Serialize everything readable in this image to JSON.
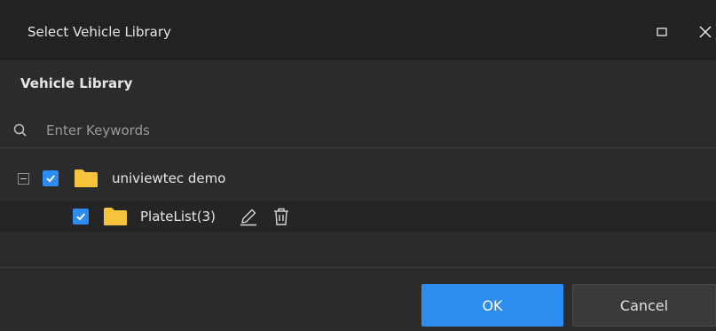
{
  "dialog": {
    "title": "Select Vehicle Library",
    "maximize_icon": "maximize-icon",
    "close_icon": "close-icon"
  },
  "library": {
    "section_label": "Vehicle Library",
    "search": {
      "placeholder": "Enter Keywords",
      "value": ""
    },
    "tree": {
      "root": {
        "label": "univiewtec demo",
        "expanded": true,
        "checked": true,
        "icon": "folder-icon"
      },
      "children": [
        {
          "label": "PlateList(3)",
          "checked": true,
          "icon": "folder-icon",
          "actions": [
            "edit-icon",
            "delete-icon"
          ]
        }
      ]
    }
  },
  "footer": {
    "ok_label": "OK",
    "cancel_label": "Cancel"
  },
  "colors": {
    "accent": "#2d8cf0",
    "folder": "#f7c33a",
    "background": "#2b2b2b",
    "titlebar": "#222222"
  }
}
